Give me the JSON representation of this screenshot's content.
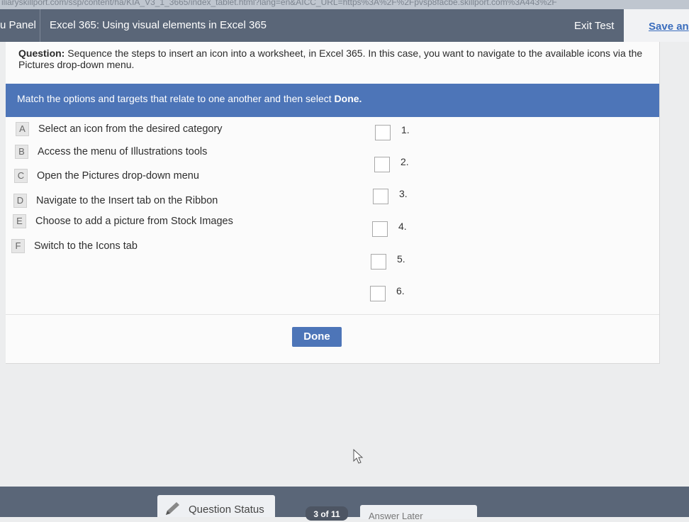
{
  "browser": {
    "url_fragment": "iliaryskillport.com/ssp/content/ha/KIA_V3_1_3665/index_tablet.html?lang=en&AICC_URL=https%3A%2F%2Fpvsp8facbe.skillport.com%3A443%2F"
  },
  "header": {
    "menu_label": "u Panel",
    "course_title": "Excel 365: Using visual elements in Excel 365",
    "exit_label": "Exit Test",
    "save_label": "Save an"
  },
  "question": {
    "prefix": "Question:",
    "text": " Sequence the steps to insert an icon into a worksheet, in Excel 365. In this case, you want to navigate to the available icons via the Pictures drop-down menu."
  },
  "instruction": {
    "text": "Match the options and targets that relate to one another and then select ",
    "emphasis": "Done."
  },
  "options": [
    {
      "letter": "A",
      "text": "Select an icon from the desired category"
    },
    {
      "letter": "B",
      "text": "Access the menu of Illustrations tools"
    },
    {
      "letter": "C",
      "text": "Open the Pictures drop-down menu"
    },
    {
      "letter": "D",
      "text": "Navigate to the Insert tab on the Ribbon"
    },
    {
      "letter": "E",
      "text": "Choose to add a picture from Stock Images"
    },
    {
      "letter": "F",
      "text": "Switch to the Icons tab"
    }
  ],
  "targets": [
    {
      "label": "1."
    },
    {
      "label": "2."
    },
    {
      "label": "3."
    },
    {
      "label": "4."
    },
    {
      "label": "5."
    },
    {
      "label": "6."
    }
  ],
  "done_label": "Done",
  "footer": {
    "status_label": "Question Status",
    "page_indicator": "3 of 11",
    "answer_label": "Answer Later"
  },
  "colors": {
    "header": "#5a6678",
    "accent": "#4d75b8",
    "link": "#3a6dbd"
  }
}
